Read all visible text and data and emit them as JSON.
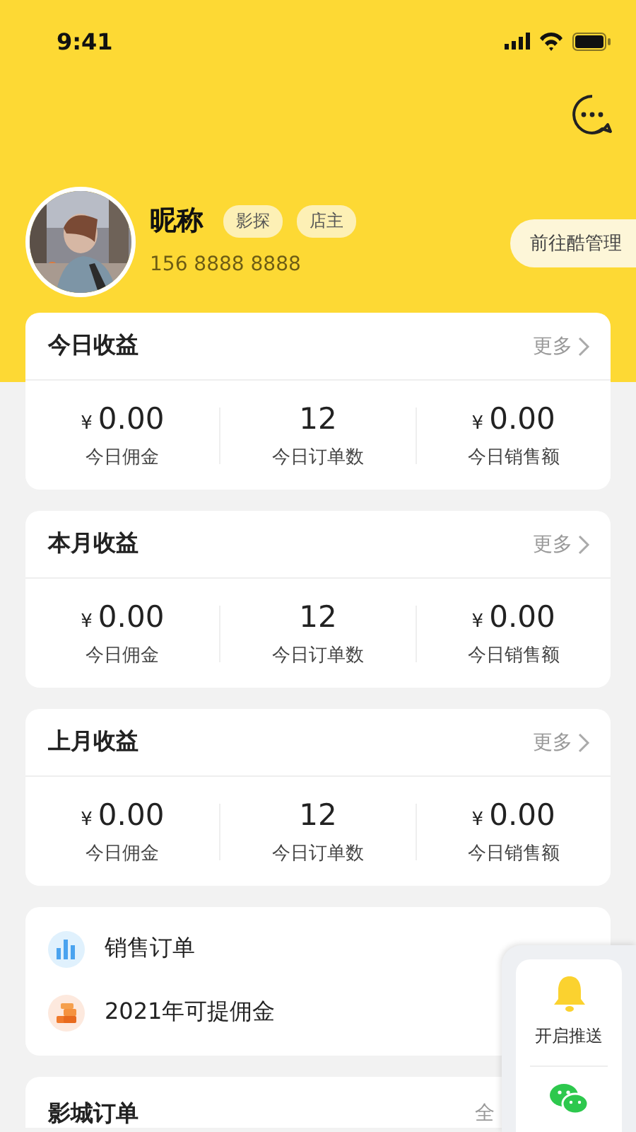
{
  "status_bar": {
    "time": "9:41"
  },
  "profile": {
    "name": "昵称",
    "tags": [
      "影探",
      "店主"
    ],
    "phone": "156 8888 8888",
    "manage_button": "前往酷管理"
  },
  "stat_cards": [
    {
      "title": "今日收益",
      "more": "更多",
      "stats": [
        {
          "currency": "¥",
          "value": "0.00",
          "label": "今日佣金"
        },
        {
          "value": "12",
          "label": "今日订单数"
        },
        {
          "currency": "¥",
          "value": "0.00",
          "label": "今日销售额"
        }
      ]
    },
    {
      "title": "本月收益",
      "more": "更多",
      "stats": [
        {
          "currency": "¥",
          "value": "0.00",
          "label": "今日佣金"
        },
        {
          "value": "12",
          "label": "今日订单数"
        },
        {
          "currency": "¥",
          "value": "0.00",
          "label": "今日销售额"
        }
      ]
    },
    {
      "title": "上月收益",
      "more": "更多",
      "stats": [
        {
          "currency": "¥",
          "value": "0.00",
          "label": "今日佣金"
        },
        {
          "value": "12",
          "label": "今日订单数"
        },
        {
          "currency": "¥",
          "value": "0.00",
          "label": "今日销售额"
        }
      ]
    }
  ],
  "menu": [
    {
      "kind": "chart",
      "label": "销售订单"
    },
    {
      "kind": "coins",
      "label": "2021年可提佣金"
    }
  ],
  "cinema_orders": {
    "title": "影城订单",
    "more": "全"
  },
  "float_panel": {
    "items": [
      {
        "kind": "bell",
        "label": "开启推送"
      },
      {
        "kind": "wechat"
      }
    ]
  }
}
